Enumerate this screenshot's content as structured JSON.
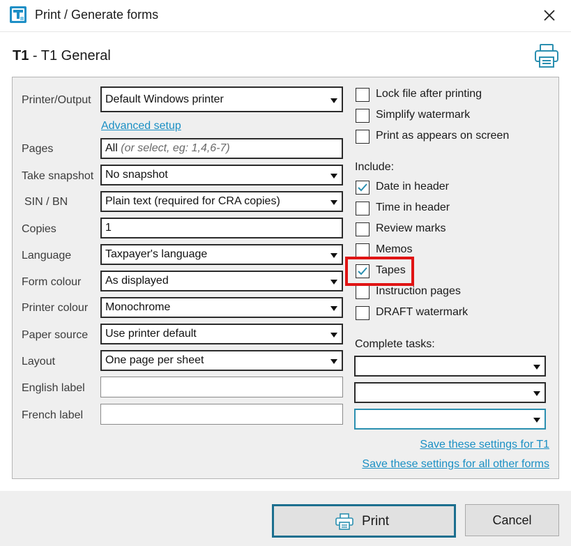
{
  "window": {
    "title": "Print / Generate forms",
    "app_icon": "t-app-icon",
    "close_icon": "close-icon"
  },
  "form": {
    "code": "T1",
    "separator": " - ",
    "name": "T1 General",
    "print_icon": "printer-icon"
  },
  "left": {
    "printer_output": {
      "label": "Printer/Output",
      "value": "Default Windows printer"
    },
    "advanced_setup": "Advanced setup",
    "pages": {
      "label": "Pages",
      "value": "All",
      "hint": "(or select, eg: 1,4,6-7)"
    },
    "snapshot": {
      "label": "Take snapshot",
      "value": "No snapshot"
    },
    "sin_bn": {
      "label": "SIN / BN",
      "value": "Plain text (required for CRA copies)"
    },
    "copies": {
      "label": "Copies",
      "value": "1"
    },
    "language": {
      "label": "Language",
      "value": "Taxpayer's language"
    },
    "form_colour": {
      "label": "Form colour",
      "value": "As displayed"
    },
    "printer_colour": {
      "label": "Printer colour",
      "value": "Monochrome"
    },
    "paper_source": {
      "label": "Paper source",
      "value": "Use printer default"
    },
    "layout": {
      "label": "Layout",
      "value": "One page per sheet"
    },
    "english_label": {
      "label": "English label",
      "value": ""
    },
    "french_label": {
      "label": "French label",
      "value": ""
    }
  },
  "right": {
    "options": [
      {
        "label": "Lock file after printing",
        "checked": false
      },
      {
        "label": "Simplify watermark",
        "checked": false
      },
      {
        "label": "Print as appears on screen",
        "checked": false
      }
    ],
    "include_label": "Include:",
    "include": [
      {
        "label": "Date in header",
        "checked": true
      },
      {
        "label": "Time in header",
        "checked": false
      },
      {
        "label": "Review marks",
        "checked": false
      },
      {
        "label": "Memos",
        "checked": false
      },
      {
        "label": "Tapes",
        "checked": true
      },
      {
        "label": "Instruction pages",
        "checked": false
      },
      {
        "label": "DRAFT watermark",
        "checked": false
      }
    ],
    "complete_tasks_label": "Complete tasks:",
    "task_dropdowns": [
      "",
      "",
      ""
    ],
    "save_t1": "Save these settings for T1",
    "save_all": "Save these settings for all other forms"
  },
  "footer": {
    "print_label": "Print",
    "print_icon": "printer-icon",
    "cancel_label": "Cancel"
  },
  "colors": {
    "accent_link": "#1a8fc4",
    "highlight": "#e01414",
    "check": "#2a8fb0",
    "primary_border": "#1c6f8f"
  }
}
